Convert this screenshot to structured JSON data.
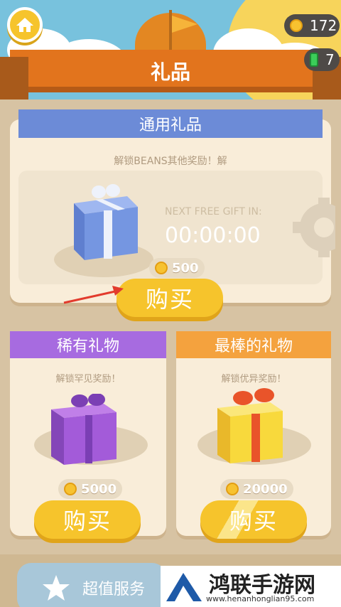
{
  "header": {
    "title": "礼品",
    "coins": "172",
    "gems": "7",
    "icons": {
      "home": "home-icon",
      "coin": "coin-icon",
      "gem": "gem-icon",
      "flag": "flag-icon"
    }
  },
  "common_gift": {
    "ribbon": "通用礼品",
    "unlock_text": "解锁BEANS其他奖励！解",
    "next_free_label": "NEXT FREE GIFT IN:",
    "timer": "00:00:00",
    "price": "500",
    "buy_label": "购买",
    "gift_color": "#7596e1"
  },
  "rare_gift": {
    "ribbon": "稀有礼物",
    "unlock_text": "解锁罕见奖励！",
    "price": "5000",
    "buy_label": "购买",
    "ribbon_color": "#a76be0",
    "gift_color": "#a35bd9"
  },
  "best_gift": {
    "ribbon": "最棒的礼物",
    "unlock_text": "解锁优异奖励！",
    "price": "20000",
    "buy_label": "购买",
    "ribbon_color": "#f4a23e",
    "gift_color": "#f8d93c"
  },
  "bottom": {
    "service_label": "超值服务",
    "watermark_title": "鸿联手游网",
    "watermark_url": "www.henanhonglian95.com"
  },
  "colors": {
    "accent": "#e2741d",
    "button": "#f6c42c",
    "sky": "#78c2dd"
  }
}
